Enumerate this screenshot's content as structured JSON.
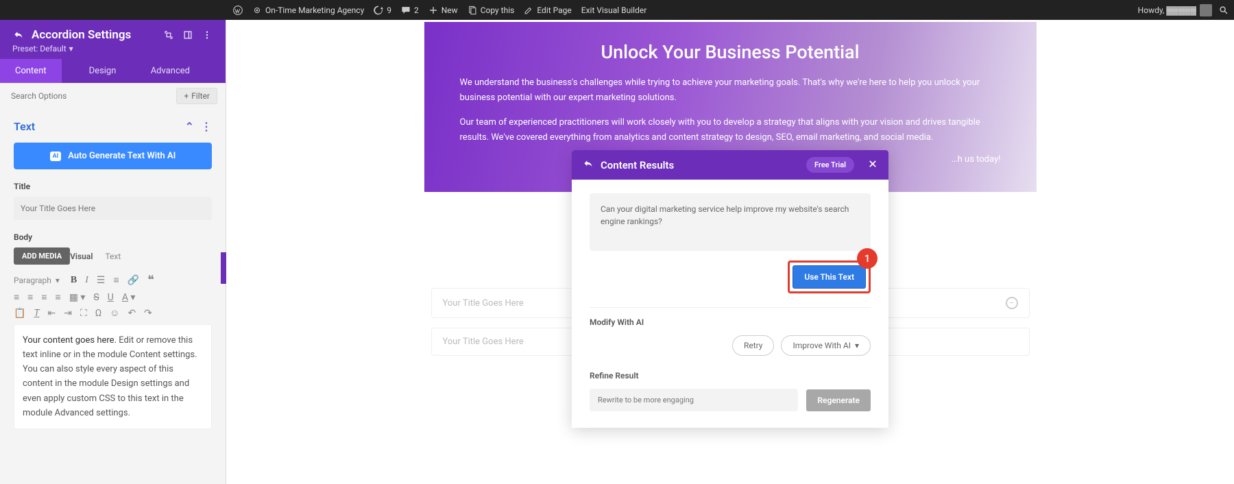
{
  "adminbar": {
    "site_name": "On-Time Marketing Agency",
    "updates_count": "9",
    "comments_count": "2",
    "new_label": "New",
    "copy_label": "Copy this",
    "edit_page_label": "Edit Page",
    "exit_vb_label": "Exit Visual Builder",
    "user_greeting": "Howdy, ▓▓▓▓▓"
  },
  "sidebar": {
    "title": "Accordion Settings",
    "preset_label": "Preset: Default",
    "tabs": {
      "content": "Content",
      "design": "Design",
      "advanced": "Advanced"
    },
    "search_placeholder": "Search Options",
    "filter_label": "Filter",
    "section_text": "Text",
    "auto_gen_label": "Auto Generate Text With AI",
    "title_label": "Title",
    "title_placeholder": "Your Title Goes Here",
    "body_label": "Body",
    "add_media_label": "ADD MEDIA",
    "editor_tab_visual": "Visual",
    "editor_tab_text": "Text",
    "paragraph_label": "Paragraph",
    "body_highlight": "Your content goes here.",
    "body_rest": " Edit or remove this text inline or in the module Content settings. You can also style every aspect of this content in the module Design settings and even apply custom CSS to this text in the module Advanced settings."
  },
  "hero": {
    "heading": "Unlock Your Business Potential",
    "p1": "We understand the business's challenges while trying to achieve your marketing goals. That's why we're here to help you unlock your business potential with our expert marketing solutions.",
    "p2": "Our team of experienced practitioners will work closely with you to develop a strategy that aligns with your vision and drives tangible results. We've covered everything from analytics and content strategy to design, SEO, email marketing, and social media.",
    "p3_tail": "h us today!"
  },
  "accordion_items": [
    {
      "title": "Your Title Goes Here"
    },
    {
      "title": "Your Title Goes Here"
    }
  ],
  "modal": {
    "title": "Content Results",
    "free_trial": "Free Trial",
    "result_text": "Can your digital marketing service help improve my website's search engine rankings?",
    "use_text_label": "Use This Text",
    "badge_num": "1",
    "modify_label": "Modify With AI",
    "retry_label": "Retry",
    "improve_label": "Improve With AI",
    "refine_label": "Refine Result",
    "refine_placeholder": "Rewrite to be more engaging",
    "regenerate_label": "Regenerate"
  }
}
